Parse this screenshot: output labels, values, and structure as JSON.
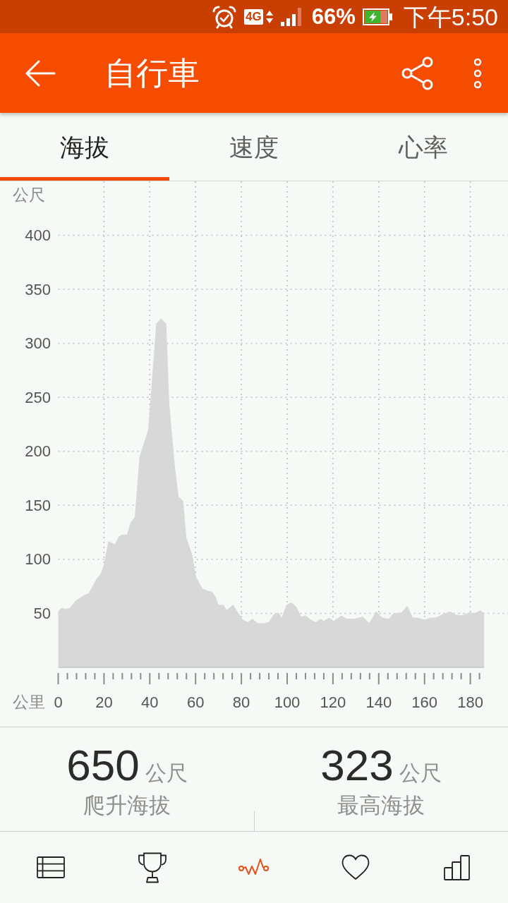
{
  "status_bar": {
    "network": "4G",
    "battery": "66%",
    "time": "下午5:50"
  },
  "app_bar": {
    "title": "自行車"
  },
  "tabs": [
    {
      "label": "海拔",
      "selected": true
    },
    {
      "label": "速度",
      "selected": false
    },
    {
      "label": "心率",
      "selected": false
    }
  ],
  "chart": {
    "chart_data": {
      "type": "area",
      "xlabel": "公里",
      "ylabel": "公尺",
      "x": [
        0,
        1.4,
        3.5,
        5,
        7.8,
        11.3,
        13.4,
        17,
        18.4,
        19.8,
        21.9,
        24.8,
        26.4,
        28,
        30,
        31.6,
        33.4,
        35.5,
        39.3,
        42.8,
        44.9,
        47.2,
        48.5,
        51,
        52.6,
        54.6,
        56,
        58.6,
        60.2,
        63,
        65.1,
        67.2,
        68.6,
        70,
        72.2,
        73.6,
        76.4,
        78.5,
        80.7,
        82.8,
        84.9,
        87,
        89.8,
        92,
        94.1,
        96.2,
        97.6,
        99.7,
        101.9,
        104,
        106.1,
        108.2,
        110.4,
        112.5,
        114.6,
        116,
        118.2,
        120.3,
        123.8,
        125.9,
        129.5,
        133,
        135.8,
        138.9,
        141.5,
        144.3,
        146.4,
        150,
        152.5,
        154.9,
        157,
        159.9,
        162.7,
        164.8,
        167.7,
        171.2,
        173.3,
        176.2,
        179.7,
        181.8,
        184.4,
        186
      ],
      "values": [
        52,
        55,
        54,
        55,
        62,
        67,
        69,
        83,
        86,
        94,
        117,
        114,
        121,
        123,
        123,
        134,
        139,
        195,
        220,
        318,
        323,
        318,
        245,
        185,
        158,
        154,
        120,
        104,
        84,
        73,
        71,
        70,
        66,
        58,
        58,
        53,
        58,
        51,
        44,
        42,
        45,
        41,
        41,
        42,
        49,
        51,
        46,
        58,
        60,
        56,
        47,
        48,
        44,
        42,
        45,
        43,
        46,
        43,
        48,
        45,
        45,
        47,
        41,
        52,
        46,
        45,
        50,
        51,
        57,
        46,
        46,
        44,
        46,
        46,
        49,
        52,
        49,
        48,
        51,
        50,
        53,
        50
      ],
      "xlim": [
        0,
        186
      ],
      "ylim": [
        0,
        450
      ],
      "xticks": [
        0,
        20,
        40,
        60,
        80,
        100,
        120,
        140,
        160,
        180
      ],
      "yticks": [
        50,
        100,
        150,
        200,
        250,
        300,
        350,
        400
      ],
      "grid": true
    }
  },
  "stats": [
    {
      "value": "650",
      "unit": "公尺",
      "label": "爬升海拔"
    },
    {
      "value": "323",
      "unit": "公尺",
      "label": "最高海拔"
    }
  ],
  "bottom_nav": [
    {
      "kind": "table",
      "selected": false
    },
    {
      "kind": "trophy",
      "selected": false
    },
    {
      "kind": "activity",
      "selected": true
    },
    {
      "kind": "heart",
      "selected": false
    },
    {
      "kind": "chart",
      "selected": false
    }
  ]
}
